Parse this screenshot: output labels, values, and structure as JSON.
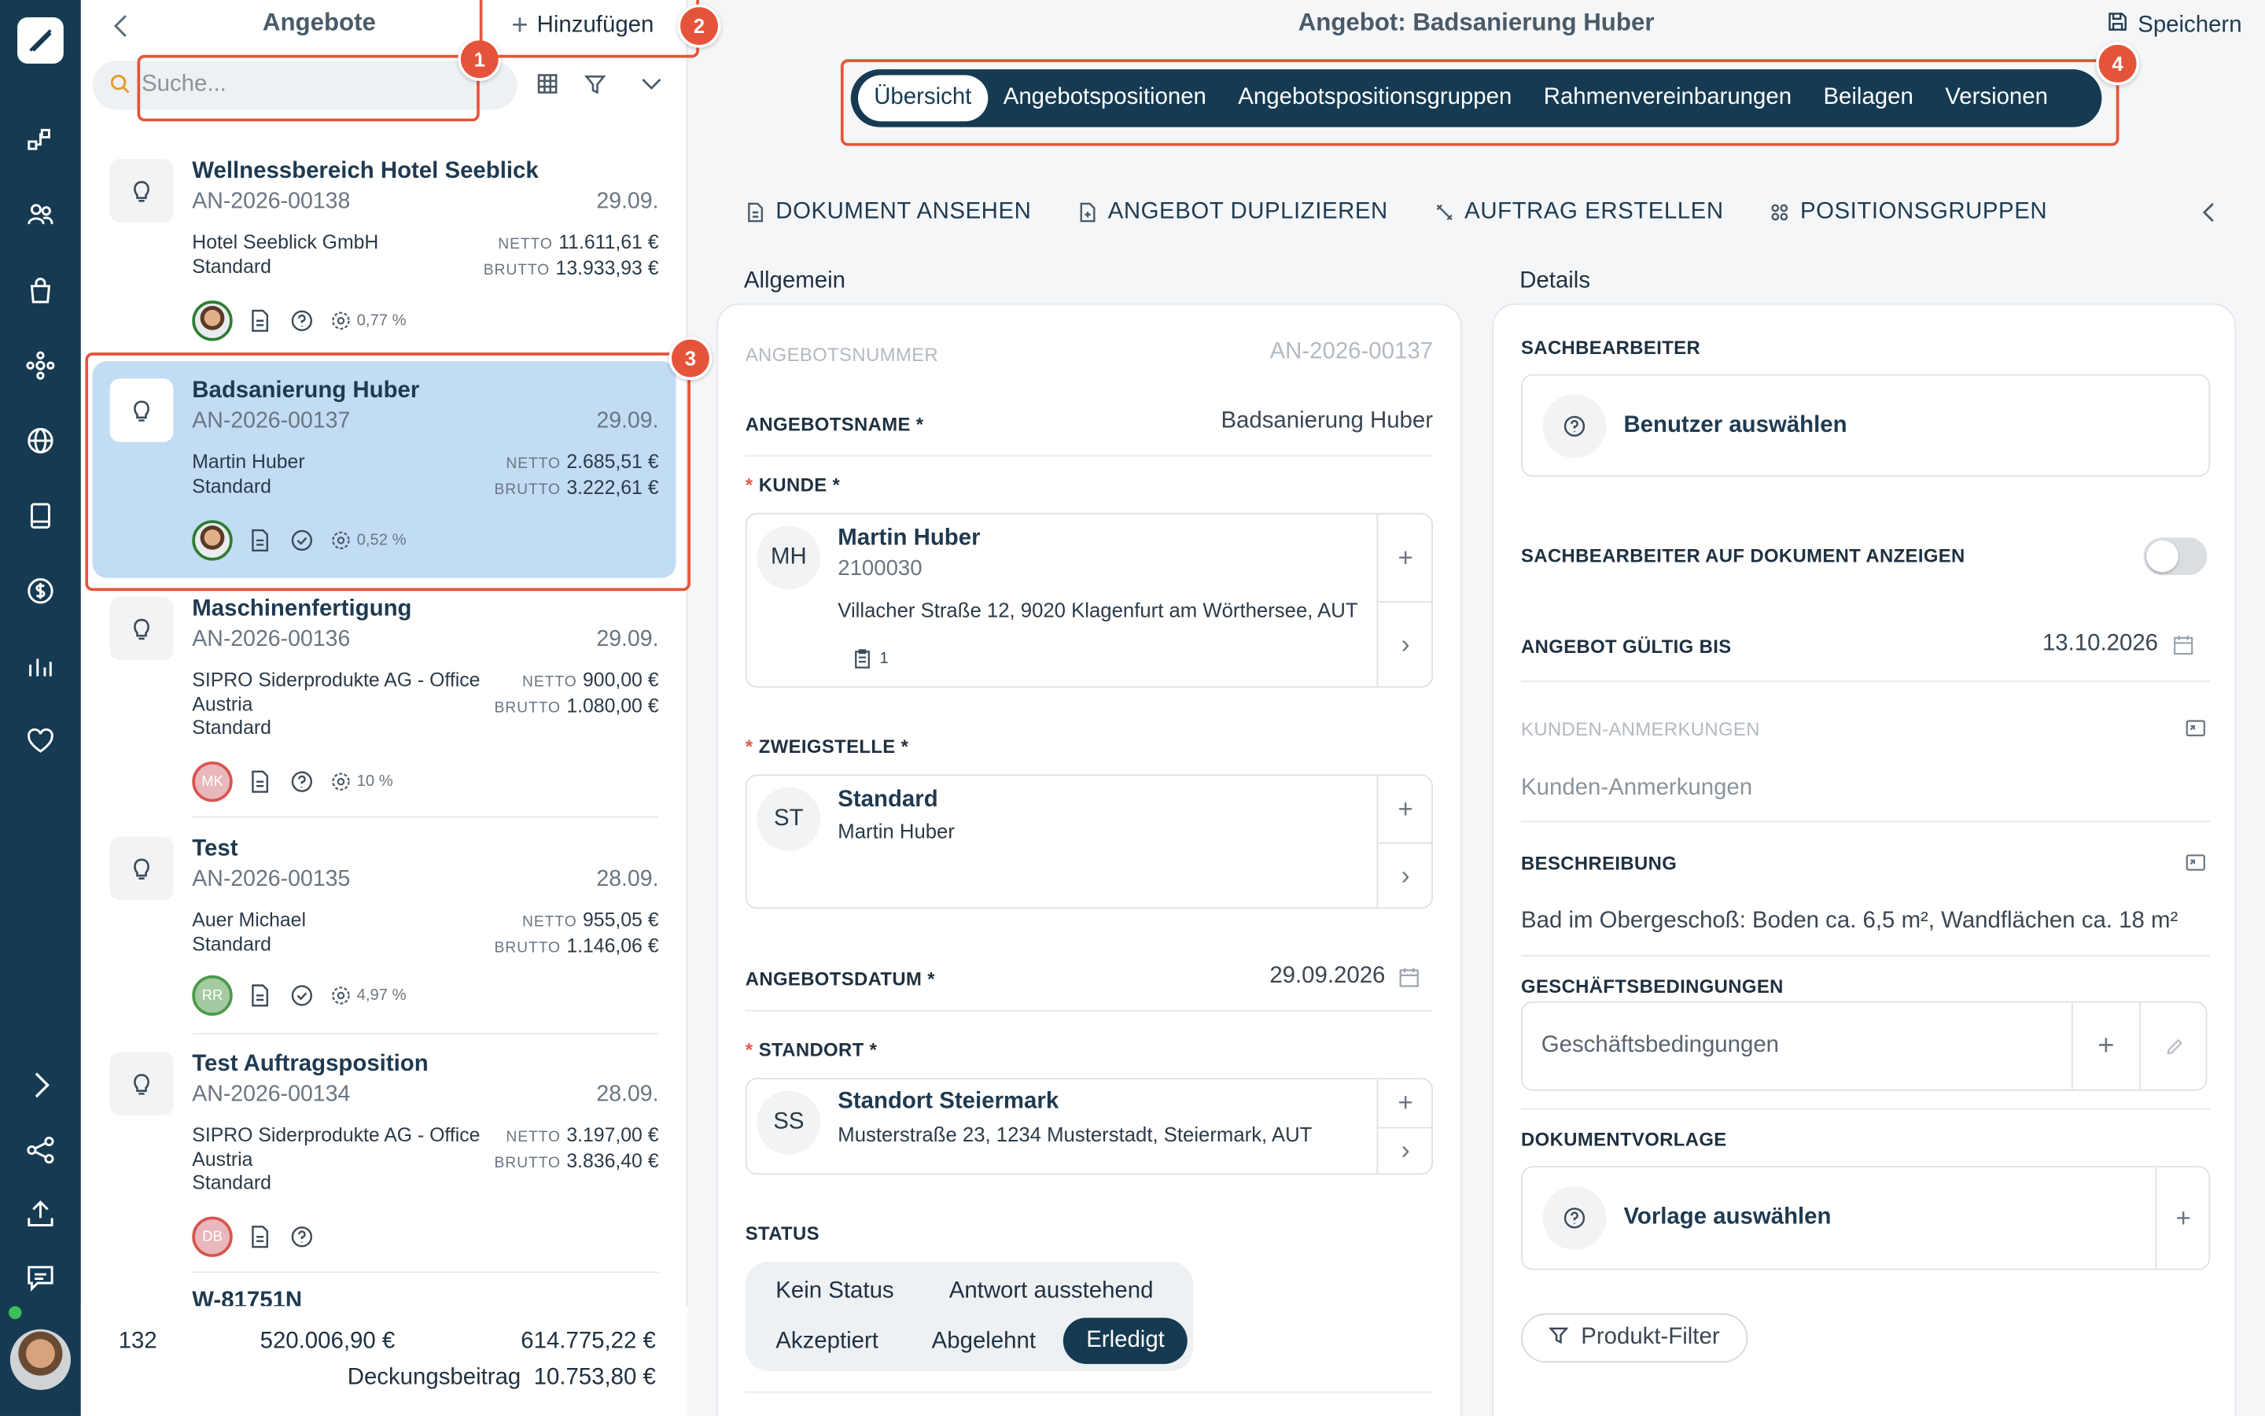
{
  "list": {
    "title": "Angebote",
    "add_label": "Hinzufügen",
    "search_placeholder": "Suche...",
    "netto_label": "NETTO",
    "brutto_label": "BRUTTO",
    "items": [
      {
        "name": "Wellnessbereich Hotel Seeblick",
        "number": "AN-2026-00138",
        "date": "29.09.",
        "customer": "Hotel Seeblick GmbH",
        "branch": "Standard",
        "netto": "11.611,61 €",
        "brutto": "13.933,93 €",
        "avatar": "",
        "avatar_type": "photo",
        "status_icon": "help-icon",
        "pct": "0,77 %"
      },
      {
        "name": "Badsanierung Huber",
        "number": "AN-2026-00137",
        "date": "29.09.",
        "customer": "Martin Huber",
        "branch": "Standard",
        "netto": "2.685,51 €",
        "brutto": "3.222,61 €",
        "avatar": "",
        "avatar_type": "photo",
        "status_icon": "check-circle-icon",
        "pct": "0,52 %"
      },
      {
        "name": "Maschinenfertigung",
        "number": "AN-2026-00136",
        "date": "29.09.",
        "customer": "SIPRO Siderprodukte AG - Office Austria",
        "branch": "Standard",
        "netto": "900,00 €",
        "brutto": "1.080,00 €",
        "avatar": "MK",
        "avatar_type": "mk",
        "status_icon": "help-icon",
        "pct": "10 %"
      },
      {
        "name": "Test",
        "number": "AN-2026-00135",
        "date": "28.09.",
        "customer": "Auer Michael",
        "branch": "Standard",
        "netto": "955,05 €",
        "brutto": "1.146,06 €",
        "avatar": "RR",
        "avatar_type": "rr",
        "status_icon": "check-circle-icon",
        "pct": "4,97 %"
      },
      {
        "name": "Test Auftragsposition",
        "number": "AN-2026-00134",
        "date": "28.09.",
        "customer": "SIPRO Siderprodukte AG - Office Austria",
        "branch": "Standard",
        "netto": "3.197,00 €",
        "brutto": "3.836,40 €",
        "avatar": "DB",
        "avatar_type": "db",
        "status_icon": "help-icon",
        "pct": ""
      },
      {
        "name": "W-81751N",
        "number": "",
        "date": "",
        "customer": "",
        "branch": "",
        "netto": "",
        "brutto": "",
        "avatar": "",
        "avatar_type": "",
        "status_icon": "",
        "pct": ""
      }
    ],
    "footer": {
      "count": "132",
      "netto_total": "520.006,90 €",
      "brutto_total": "614.775,22 €",
      "db_label": "Deckungsbeitrag",
      "db_value": "10.753,80 €"
    }
  },
  "main": {
    "title": "Angebot: Badsanierung Huber",
    "save_label": "Speichern",
    "tabs": [
      "Übersicht",
      "Angebotspositionen",
      "Angebotspositionsgruppen",
      "Rahmenvereinbarungen",
      "Beilagen",
      "Versionen"
    ],
    "active_tab": "Übersicht",
    "actions": [
      "DOKUMENT ANSEHEN",
      "ANGEBOT DUPLIZIEREN",
      "AUFTRAG ERSTELLEN",
      "POSITIONSGRUPPEN"
    ],
    "general": {
      "heading": "Allgemein",
      "number_label": "ANGEBOTSNUMMER",
      "number_value": "AN-2026-00137",
      "name_label": "ANGEBOTSNAME *",
      "name_value": "Badsanierung Huber",
      "customer_label": "KUNDE *",
      "customer": {
        "initials": "MH",
        "name": "Martin Huber",
        "id": "2100030",
        "address": "Villacher Straße 12, 9020 Klagenfurt am Wörthersee, AUT",
        "doc_count": "1"
      },
      "branch_label": "ZWEIGSTELLE *",
      "branch": {
        "initials": "ST",
        "name": "Standard",
        "person": "Martin Huber"
      },
      "date_label": "ANGEBOTSDATUM *",
      "date_value": "29.09.2026",
      "location_label": "STANDORT *",
      "location": {
        "initials": "SS",
        "name": "Standort Steiermark",
        "address": "Musterstraße 23, 1234 Musterstadt, Steiermark, AUT"
      },
      "status_label": "STATUS",
      "status_options": [
        "Kein Status",
        "Antwort ausstehend",
        "Akzeptiert",
        "Abgelehnt",
        "Erledigt"
      ],
      "status_selected": "Erledigt"
    },
    "details": {
      "heading": "Details",
      "clerk_label": "SACHBEARBEITER",
      "clerk_placeholder": "Benutzer auswählen",
      "show_clerk_label": "SACHBEARBEITER AUF DOKUMENT ANZEIGEN",
      "show_clerk_on": false,
      "valid_label": "ANGEBOT GÜLTIG BIS",
      "valid_value": "13.10.2026",
      "notes_label": "KUNDEN-ANMERKUNGEN",
      "notes_placeholder": "Kunden-Anmerkungen",
      "desc_label": "BESCHREIBUNG",
      "desc_value": "Bad im Obergeschoß: Boden ca. 6,5 m², Wandflächen ca. 18 m²",
      "terms_label": "GESCHÄFTSBEDINGUNGEN",
      "terms_placeholder": "Geschäftsbedingungen",
      "template_label": "DOKUMENTVORLAGE",
      "template_placeholder": "Vorlage auswählen",
      "product_filter_label": "Produkt-Filter"
    }
  },
  "callouts": [
    "1",
    "2",
    "3",
    "4"
  ],
  "colors": {
    "primary": "#153a52",
    "accent": "#e5543a",
    "selected": "#c2dcf4"
  }
}
